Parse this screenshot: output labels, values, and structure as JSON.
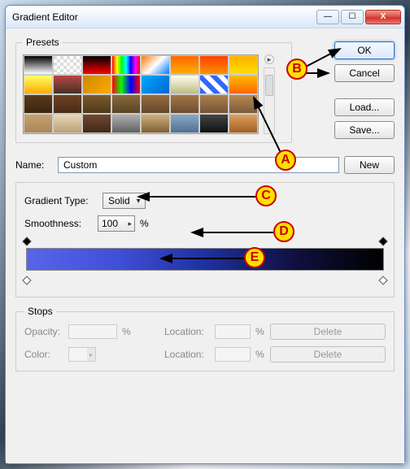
{
  "title": "Gradient Editor",
  "win_buttons": {
    "min": "—",
    "max": "☐",
    "close": "X"
  },
  "side_buttons": {
    "ok": "OK",
    "cancel": "Cancel",
    "load": "Load...",
    "save": "Save...",
    "new": "New",
    "delete": "Delete"
  },
  "presets": {
    "legend": "Presets",
    "swatches": [
      "linear-gradient(#000,#fff)",
      "repeating-conic-gradient(#fff 0 25%, #ddd 0 50%) 0 0/8px 8px",
      "linear-gradient(#000,#ff0000)",
      "linear-gradient(90deg,#f00,#ff0,#0f0,#0ff,#00f,#f0f,#f00)",
      "linear-gradient(135deg,#f70,#fff,#07f)",
      "linear-gradient(#ff6600,#ffb000)",
      "linear-gradient(#ff4000,#ff9000)",
      "linear-gradient(#ffb000,#ffe000)",
      "linear-gradient(#ffff66,#ffaa00)",
      "linear-gradient(#b44,#432)",
      "linear-gradient(135deg,#c80,#fa0)",
      "linear-gradient(90deg,#f00,#0f0,#00f,#f00)",
      "linear-gradient(135deg,#0af,#06c)",
      "linear-gradient(#ffe,#bb8)",
      "repeating-linear-gradient(45deg,#36f 0 6px,#fff 6px 12px)",
      "linear-gradient(#fb0,#f60)",
      "linear-gradient(#5a3b1a,#3a2510)",
      "linear-gradient(#6b4226,#4a2c16)",
      "linear-gradient(#7a5a30,#503818)",
      "linear-gradient(#8a6a40,#5a4422)",
      "linear-gradient(#986c3e,#62482a)",
      "linear-gradient(#a47644,#6a4e30)",
      "linear-gradient(#ae804c,#725436)",
      "linear-gradient(#b88a54,#7a5a3c)",
      "linear-gradient(#c8a070,#a88858)",
      "linear-gradient(#e8d8b8,#b8a078)",
      "linear-gradient(#704830,#402818)",
      "linear-gradient(#b0b0b0,#606060)",
      "linear-gradient(#d0b080,#806030)",
      "linear-gradient(#88a8c8,#507090)",
      "linear-gradient(#444,#111)",
      "linear-gradient(#dda060,#a06020)"
    ]
  },
  "name_label": "Name:",
  "name_value": "Custom",
  "gradfs": {
    "type_label": "Gradient Type:",
    "type_value": "Solid",
    "smooth_label": "Smoothness:",
    "smooth_value": "100",
    "pct": "%"
  },
  "stops": {
    "legend": "Stops",
    "opacity_label": "Opacity:",
    "color_label": "Color:",
    "location_label": "Location:",
    "pct": "%"
  },
  "callouts": {
    "a": "A",
    "b": "B",
    "c": "C",
    "d": "D",
    "e": "E"
  }
}
